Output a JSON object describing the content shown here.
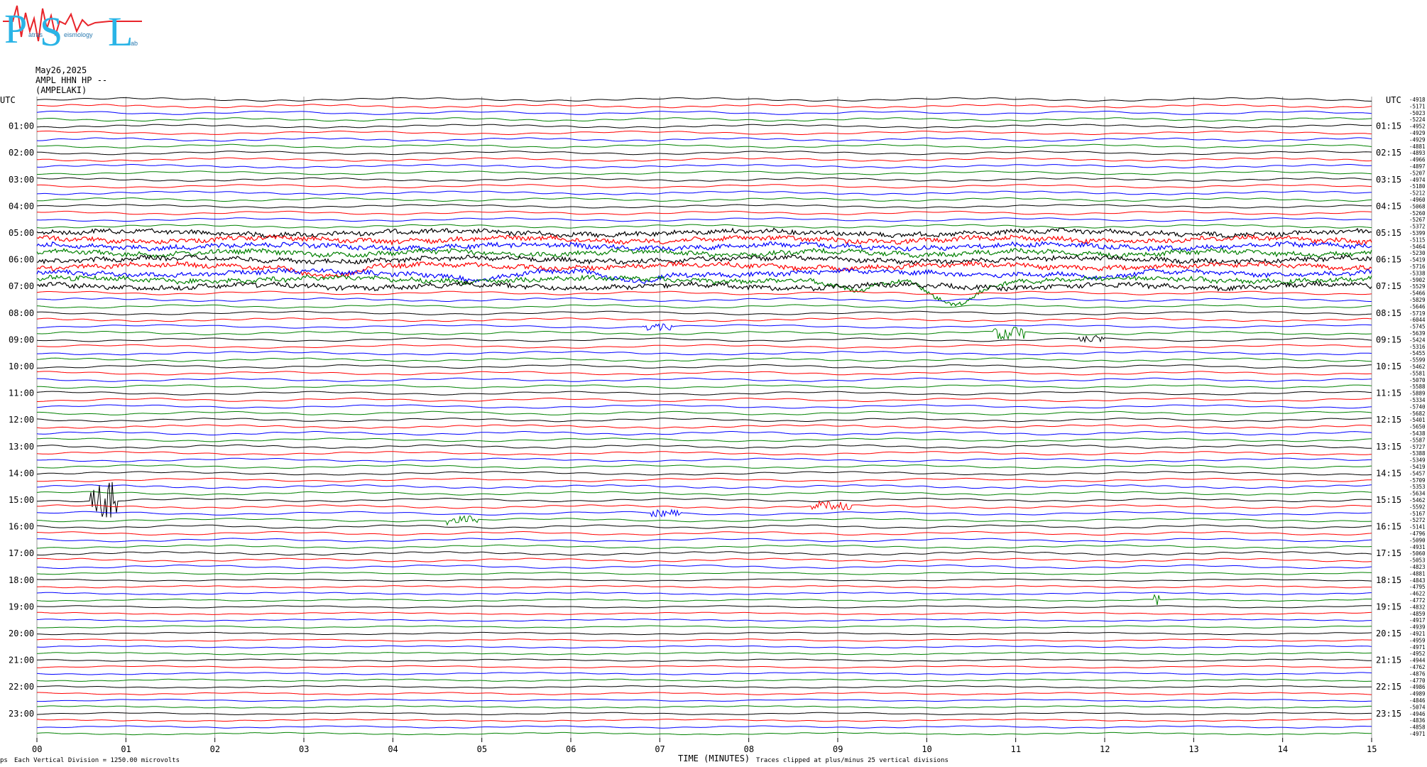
{
  "logo": {
    "letters": [
      "P",
      "S",
      "L"
    ],
    "words": [
      "atras",
      "eismology",
      "ab"
    ]
  },
  "header": {
    "date": "May26,2025",
    "station": "AMPL HHN HP --",
    "location": "(AMPELAKI)"
  },
  "footer": {
    "scale_note": "Each Vertical Division = 1250.00 microvolts",
    "clip_note": "Traces clipped at plus/minus 25 vertical divisions",
    "marker": "ps"
  },
  "chart_data": {
    "type": "helicorder",
    "xlabel": "TIME (MINUTES)",
    "x_ticks": [
      "00",
      "01",
      "02",
      "03",
      "04",
      "05",
      "06",
      "07",
      "08",
      "09",
      "10",
      "11",
      "12",
      "13",
      "14",
      "15"
    ],
    "xlim": [
      0,
      15
    ],
    "left_axis_title": "UTC",
    "right_axis_title": "UTC",
    "left_labels": [
      "01:00",
      "02:00",
      "03:00",
      "04:00",
      "05:00",
      "06:00",
      "07:00",
      "08:00",
      "09:00",
      "10:00",
      "11:00",
      "12:00",
      "13:00",
      "14:00",
      "15:00",
      "16:00",
      "17:00",
      "18:00",
      "19:00",
      "20:00",
      "21:00",
      "22:00",
      "23:00"
    ],
    "right_labels": [
      "01:15",
      "02:15",
      "03:15",
      "04:15",
      "05:15",
      "06:15",
      "07:15",
      "08:15",
      "09:15",
      "10:15",
      "11:15",
      "12:15",
      "13:15",
      "14:15",
      "15:15",
      "16:15",
      "17:15",
      "18:15",
      "19:15",
      "20:15",
      "21:15",
      "22:15",
      "23:15"
    ],
    "color_cycle": [
      "#000000",
      "#ff0000",
      "#0000ff",
      "#008000"
    ],
    "trace_count": 96,
    "trace_minutes": 15,
    "trace_offsets": [
      "-4918",
      "-5171",
      "-5023",
      "-5224",
      "-4952",
      "-4929",
      "-4929",
      "-4881",
      "-4893",
      "-4966",
      "-4897",
      "-5207",
      "-4974",
      "-5180",
      "-5212",
      "-4960",
      "-5068",
      "-5260",
      "-5267",
      "-5372",
      "-5399",
      "-5115",
      "-5464",
      "-5230",
      "-5419",
      "-5716",
      "-5338",
      "-5902",
      "-5529",
      "-5466",
      "-5829",
      "-5646",
      "-5719",
      "-6044",
      "-5745",
      "-5639",
      "-5424",
      "-5316",
      "-5455",
      "-5599",
      "-5462",
      "-5581",
      "-5070",
      "-5588",
      "-5889",
      "-5334",
      "-5740",
      "-5682",
      "-5401",
      "-5650",
      "-5438",
      "-5587",
      "-5727",
      "-5388",
      "-5349",
      "-5419",
      "-5457",
      "-5709",
      "-5353",
      "-5634",
      "-5462",
      "-5592",
      "-5167",
      "-5272",
      "-5141",
      "-4796",
      "-5090",
      "-4931",
      "-5060",
      "-5053",
      "-4823",
      "-4881",
      "-4843",
      "-4795",
      "-4622",
      "-4772",
      "-4832",
      "-4859",
      "-4917",
      "-4939",
      "-4921",
      "-4959",
      "-4971",
      "-4952",
      "-4944",
      "-4762",
      "-4876",
      "-4770",
      "-4986",
      "-4989",
      "-4846",
      "-5074",
      "-4946",
      "-4836",
      "-4858",
      "-4971"
    ],
    "events": [
      {
        "start_minute": 6.8,
        "end_minute": 7.15,
        "amplitude_divisions": 0.8
      },
      {
        "start_minute": 10.75,
        "end_minute": 11.1,
        "amplitude_divisions": 1.6
      },
      {
        "start_minute": 11.7,
        "end_minute": 12.0,
        "amplitude_divisions": 0.8
      },
      {
        "start_minute": 0.6,
        "end_minute": 0.9,
        "amplitude_divisions": 4.5
      },
      {
        "start_minute": 8.7,
        "end_minute": 9.15,
        "amplitude_divisions": 1.0
      },
      {
        "start_minute": 6.9,
        "end_minute": 7.25,
        "amplitude_divisions": 0.8
      },
      {
        "start_minute": 4.6,
        "end_minute": 4.95,
        "amplitude_divisions": 0.9
      },
      {
        "start_minute": 12.55,
        "end_minute": 12.62,
        "amplitude_divisions": 1.6
      }
    ],
    "noisy_band_start_row": 20,
    "noisy_band_end_row": 28,
    "wide_swings": [
      {
        "row": 25,
        "minute": 3.3,
        "depth_divisions": 3.0
      },
      {
        "row": 26,
        "minute": 5.0,
        "depth_divisions": 2.0
      },
      {
        "row": 26,
        "minute": 6.7,
        "depth_divisions": 3.0
      },
      {
        "row": 27,
        "minute": 9.2,
        "depth_divisions": 4.0
      },
      {
        "row": 27,
        "minute": 10.3,
        "depth_divisions": 8.0
      },
      {
        "row": 26,
        "minute": 12.0,
        "depth_divisions": 2.0
      }
    ]
  }
}
